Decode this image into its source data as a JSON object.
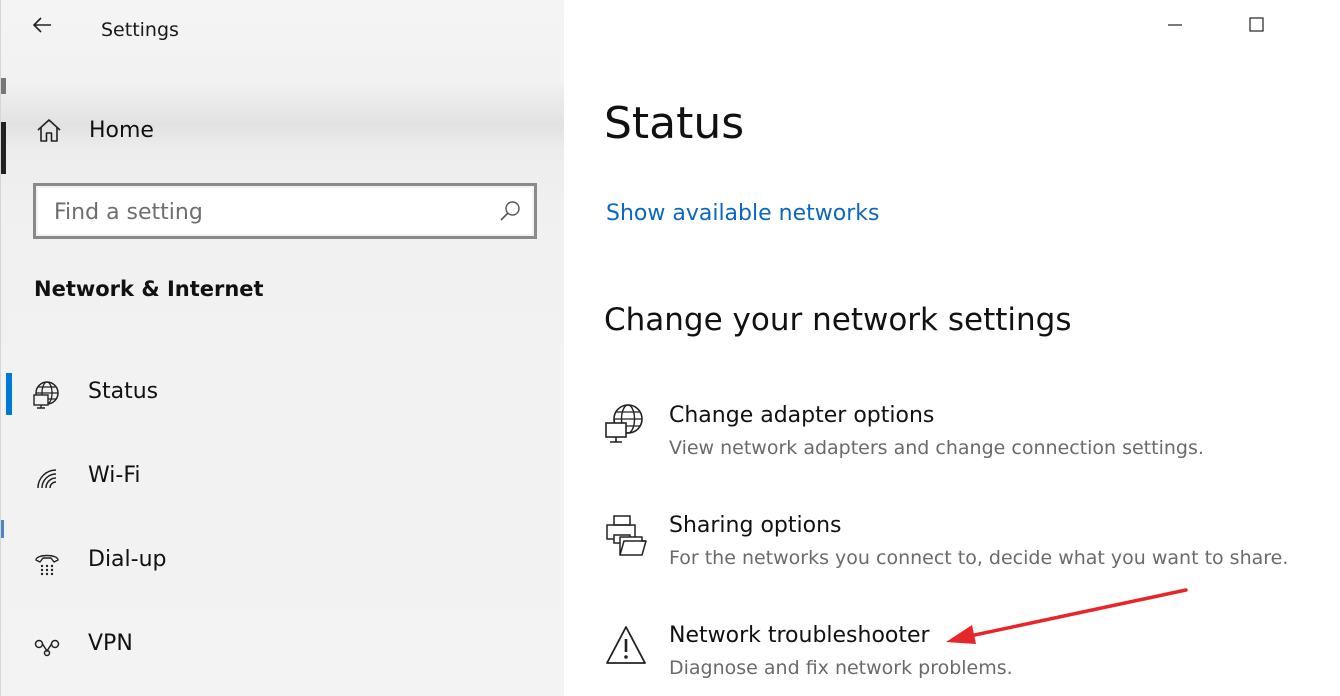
{
  "window": {
    "title": "Settings",
    "accent_color": "#0078d7",
    "link_color": "#0a67c2"
  },
  "nav": {
    "home_label": "Home",
    "home_icon": "home-icon",
    "search": {
      "placeholder": "Find a setting",
      "value": "",
      "icon": "search-icon"
    },
    "section_title": "Network & Internet",
    "items": [
      {
        "label": "Status",
        "icon": "globe-monitor-icon",
        "selected": true
      },
      {
        "label": "Wi-Fi",
        "icon": "wifi-icon",
        "selected": false
      },
      {
        "label": "Dial-up",
        "icon": "dialup-phone-icon",
        "selected": false
      },
      {
        "label": "VPN",
        "icon": "vpn-icon",
        "selected": false
      }
    ]
  },
  "main": {
    "page_title": "Status",
    "link_label": "Show available networks",
    "subheading": "Change your network settings",
    "options": [
      {
        "title": "Change adapter options",
        "description": "View network adapters and change connection settings.",
        "icon": "globe-monitor-icon"
      },
      {
        "title": "Sharing options",
        "description": "For the networks you connect to, decide what you want to share.",
        "icon": "printer-folder-icon"
      },
      {
        "title": "Network troubleshooter",
        "description": "Diagnose and fix network problems.",
        "icon": "warning-triangle-icon"
      }
    ]
  },
  "annotation": {
    "arrow_color": "#e8262a"
  }
}
